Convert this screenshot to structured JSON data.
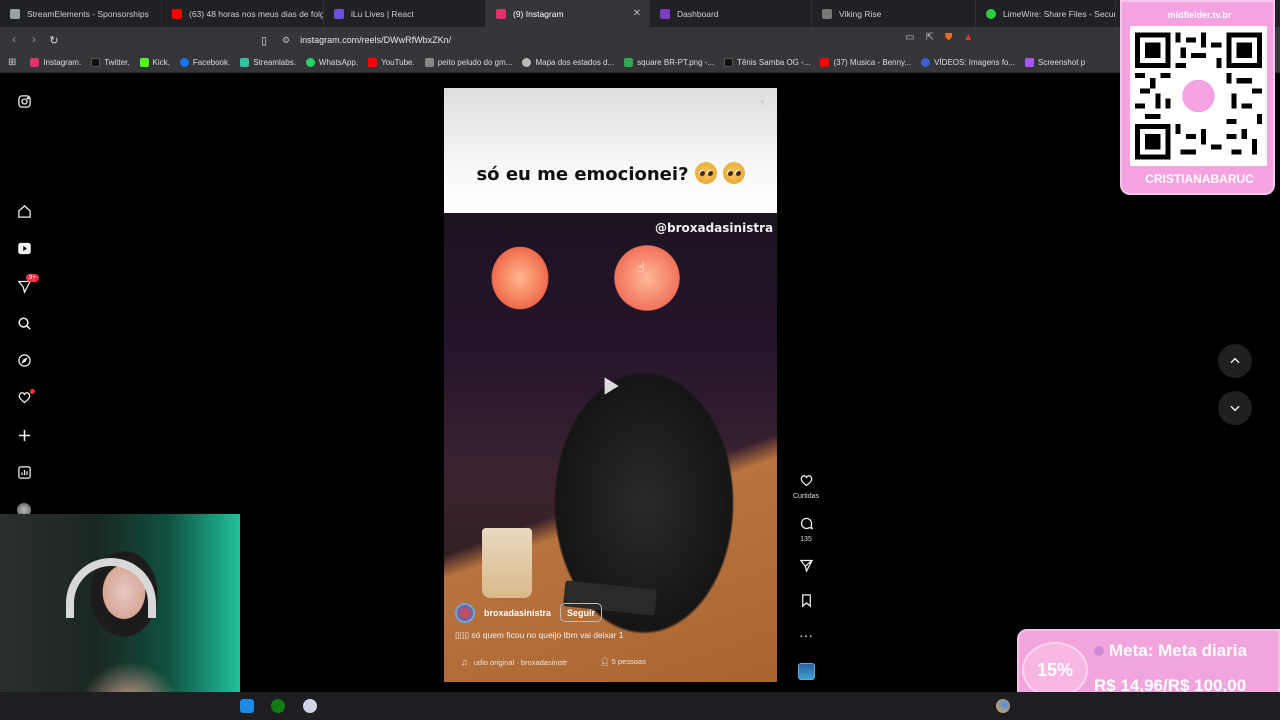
{
  "browser": {
    "tabs": [
      {
        "label": "StreamElements - Sponsorships",
        "color": "#9aa0a6"
      },
      {
        "label": "(63) 48 horas nos meus dias de folg",
        "color": "#ff0000"
      },
      {
        "label": "iLu Lives | React",
        "color": "#6e4fe0"
      },
      {
        "label": "(9) Instagram",
        "color": "#e1306c",
        "active": true
      },
      {
        "label": "Dashboard",
        "color": "#7b3fbf"
      },
      {
        "label": "Viking Rise",
        "color": "#777"
      },
      {
        "label": "LimeWire: Share Files - Secure File",
        "color": "#2ecc40"
      }
    ],
    "url": "instagram.com/reels/DWwRfWbxZKn/",
    "bookmarks": [
      {
        "label": "Instagram.",
        "color": "#e1306c"
      },
      {
        "label": "Twitter.",
        "color": "#111"
      },
      {
        "label": "Kick.",
        "color": "#53fc18"
      },
      {
        "label": "Facebook.",
        "color": "#1877f2"
      },
      {
        "label": "Streamlabs.",
        "color": "#31c3a2"
      },
      {
        "label": "WhatsApp.",
        "color": "#25d366"
      },
      {
        "label": "YouTube.",
        "color": "#ff0000"
      },
      {
        "label": "peito peludo do gm...",
        "color": "#888"
      },
      {
        "label": "Mapa dos estados d...",
        "color": "#bbb"
      },
      {
        "label": "square BR-PT.png -...",
        "color": "#34a853"
      },
      {
        "label": "Tênis Samba OG -...",
        "color": "#111"
      },
      {
        "label": "(37) Musica - Benny...",
        "color": "#ff0000"
      },
      {
        "label": "VÍDEOS: Imagens fo...",
        "color": "#3a5fcf"
      },
      {
        "label": "Screenshot p",
        "color": "#a855f7"
      }
    ]
  },
  "reel": {
    "title_text": "só eu me emocionei?",
    "watermark": "@broxadasinistra",
    "owner": "broxadasinistra",
    "follow_label": "Seguir",
    "description": "▯▯▯ só quem ficou no queijo tbm vai deixar 1",
    "audio_label": "udio original · broxadasinistr",
    "people_label": "5 pessoas"
  },
  "actions": {
    "like_label": "Curtidas",
    "comments_count": "135"
  },
  "overlay": {
    "qr_site": "midfielder.tv.br",
    "qr_name": "CRISTIANABARUC",
    "goal_percent": "15%",
    "goal_title": "Meta: Meta diaria",
    "goal_amount": "R$ 14,96/R$ 100,00"
  },
  "left_nav": {
    "notifications_badge": "9+"
  }
}
